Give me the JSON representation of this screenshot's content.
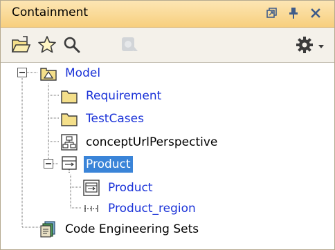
{
  "panel": {
    "title": "Containment"
  },
  "titlebar_buttons": [
    {
      "icon": "restore-icon"
    },
    {
      "icon": "pin-icon"
    },
    {
      "icon": "close-icon"
    }
  ],
  "toolbar": [
    {
      "icon": "open-folder-icon"
    },
    {
      "icon": "star-icon"
    },
    {
      "icon": "search-icon"
    },
    {
      "icon": "refresh-icon",
      "disabled": true
    },
    {
      "icon": "gear-icon"
    },
    {
      "icon": "dropdown-arrow-icon"
    }
  ],
  "tree": {
    "root": {
      "label": "Model",
      "icon": "package-icon",
      "expanded": true
    },
    "items": [
      {
        "label": "Requirement",
        "icon": "folder-icon"
      },
      {
        "label": "TestCases",
        "icon": "folder-icon"
      },
      {
        "label": "conceptUrlPerspective",
        "icon": "diagram-icon"
      },
      {
        "label": "Product",
        "icon": "block-icon",
        "expanded": true,
        "selected": true
      },
      {
        "label": "Product",
        "icon": "block-diagram-icon"
      },
      {
        "label": "Product_region",
        "icon": "region-icon"
      },
      {
        "label": "Code Engineering Sets",
        "icon": "code-sets-icon"
      }
    ]
  },
  "colors": {
    "title_bg": "#f7cf7e",
    "link_text": "#1a32d8",
    "selection": "#3a84d8"
  }
}
